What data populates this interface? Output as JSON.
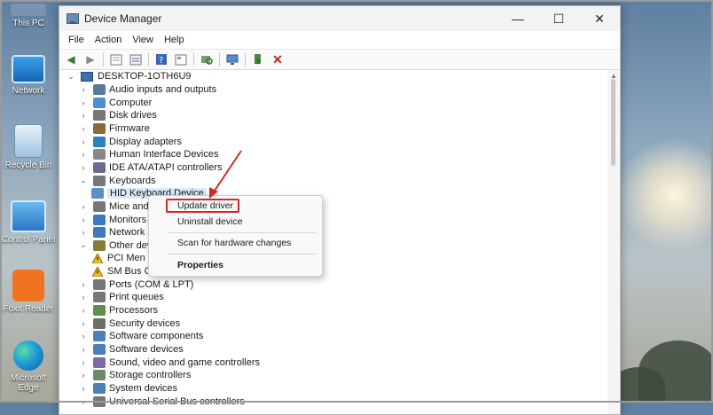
{
  "desktop": {
    "icons": [
      {
        "label": "This PC",
        "icon": "this-pc-icon"
      },
      {
        "label": "Network",
        "icon": "network-icon"
      },
      {
        "label": "Recycle Bin",
        "icon": "recycle-bin-icon"
      },
      {
        "label": "Control Panel",
        "icon": "control-panel-icon"
      },
      {
        "label": "Foxit Reader",
        "icon": "foxit-reader-icon"
      },
      {
        "label": "Microsoft Edge",
        "icon": "edge-icon"
      }
    ]
  },
  "window": {
    "title": "Device Manager",
    "controls": {
      "minimize": "—",
      "maximize": "☐",
      "close": "✕"
    }
  },
  "menu": [
    "File",
    "Action",
    "View",
    "Help"
  ],
  "tree": {
    "root": "DESKTOP-1OTH6U9",
    "nodes": [
      {
        "label": "Audio inputs and outputs",
        "state": "collapsed"
      },
      {
        "label": "Computer",
        "state": "collapsed"
      },
      {
        "label": "Disk drives",
        "state": "collapsed"
      },
      {
        "label": "Firmware",
        "state": "collapsed"
      },
      {
        "label": "Display adapters",
        "state": "collapsed"
      },
      {
        "label": "Human Interface Devices",
        "state": "collapsed"
      },
      {
        "label": "IDE ATA/ATAPI controllers",
        "state": "collapsed"
      },
      {
        "label": "Keyboards",
        "state": "expanded"
      },
      {
        "label": "HID Keyboard Device",
        "state": "child-selected"
      },
      {
        "label": "Mice and ot",
        "state": "collapsed"
      },
      {
        "label": "Monitors",
        "state": "collapsed"
      },
      {
        "label": "Network ada",
        "state": "collapsed"
      },
      {
        "label": "Other device",
        "state": "expanded"
      },
      {
        "label": "PCI Men",
        "state": "child-warning"
      },
      {
        "label": "SM Bus C",
        "state": "child-warning"
      },
      {
        "label": "Ports (COM & LPT)",
        "state": "collapsed"
      },
      {
        "label": "Print queues",
        "state": "collapsed"
      },
      {
        "label": "Processors",
        "state": "collapsed"
      },
      {
        "label": "Security devices",
        "state": "collapsed"
      },
      {
        "label": "Software components",
        "state": "collapsed"
      },
      {
        "label": "Software devices",
        "state": "collapsed"
      },
      {
        "label": "Sound, video and game controllers",
        "state": "collapsed"
      },
      {
        "label": "Storage controllers",
        "state": "collapsed"
      },
      {
        "label": "System devices",
        "state": "collapsed"
      },
      {
        "label": "Universal Serial Bus controllers",
        "state": "collapsed"
      }
    ]
  },
  "context_menu": {
    "items": [
      "Update driver",
      "Uninstall device",
      "Scan for hardware changes",
      "Properties"
    ],
    "highlighted": "Update driver"
  },
  "annotation_color": "#d12a2a"
}
